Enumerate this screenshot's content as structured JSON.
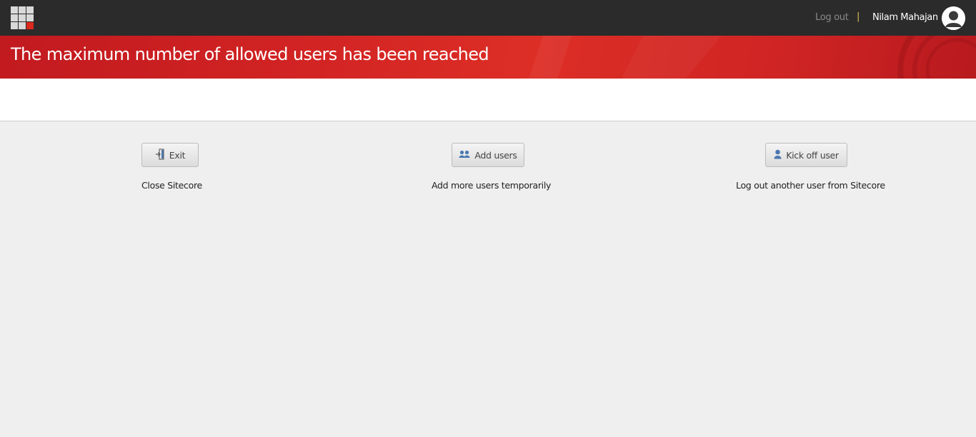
{
  "topbar": {
    "launchpad_icon": "launchpad-grid-icon",
    "logout_label": "Log out",
    "separator": "|",
    "user_name": "Nilam Mahajan",
    "avatar_icon": "user-avatar-icon"
  },
  "banner": {
    "title": "The maximum number of allowed users has been reached"
  },
  "actions": [
    {
      "icon": "exit-door-icon",
      "label": "Exit",
      "description": "Close Sitecore"
    },
    {
      "icon": "users-icon",
      "label": "Add users",
      "description": "Add more users temporarily"
    },
    {
      "icon": "user-icon",
      "label": "Kick off user",
      "description": "Log out another user from Sitecore"
    }
  ],
  "colors": {
    "topbar": "#2b2b2b",
    "banner_red": "#d12323",
    "accent_blue": "#4a78b0",
    "background": "#efefef"
  }
}
